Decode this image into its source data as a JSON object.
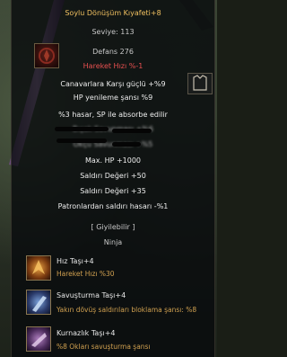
{
  "item": {
    "title": "Soylu Dönüşüm Kıyafeti+8",
    "level": "Seviye: 113",
    "defense": "Defans 276",
    "move_speed": "Hareket Hızı %-1",
    "resist": "Canavarlara Karşı güçlü +%9",
    "hp_regen": "HP yenileme şansı %9",
    "absorb": "%3 hasar, SP ile absorbe edilir",
    "blurred_1": "Bıçak Savunması +%6",
    "blurred_2": "Okçu Savunması +%5",
    "max_hp": "Max. HP +1000",
    "attack_1": "Saldırı Değeri +50",
    "attack_2": "Saldırı Değeri +35",
    "boss_dmg": "Patronlardan saldırı hasarı -%1",
    "wearable": "[ Giyilebilir ]",
    "class": "Ninja"
  },
  "sockets": [
    {
      "name": "Hız Taşı+4",
      "desc": "Hareket Hızı %30",
      "icon": "speed-stone-icon"
    },
    {
      "name": "Savuşturma Taşı+4",
      "desc": "Yakın dövüş saldırıları bloklama şansı: %8",
      "icon": "block-stone-icon"
    },
    {
      "name": "Kurnazlık Taşı+4",
      "desc": "%8 Okları savuşturma şansı",
      "icon": "arrow-stone-icon"
    }
  ],
  "colors": {
    "title": "#f0c060",
    "negative": "#e85050",
    "socket_desc": "#d0a050",
    "text": "#e6e6e6"
  }
}
